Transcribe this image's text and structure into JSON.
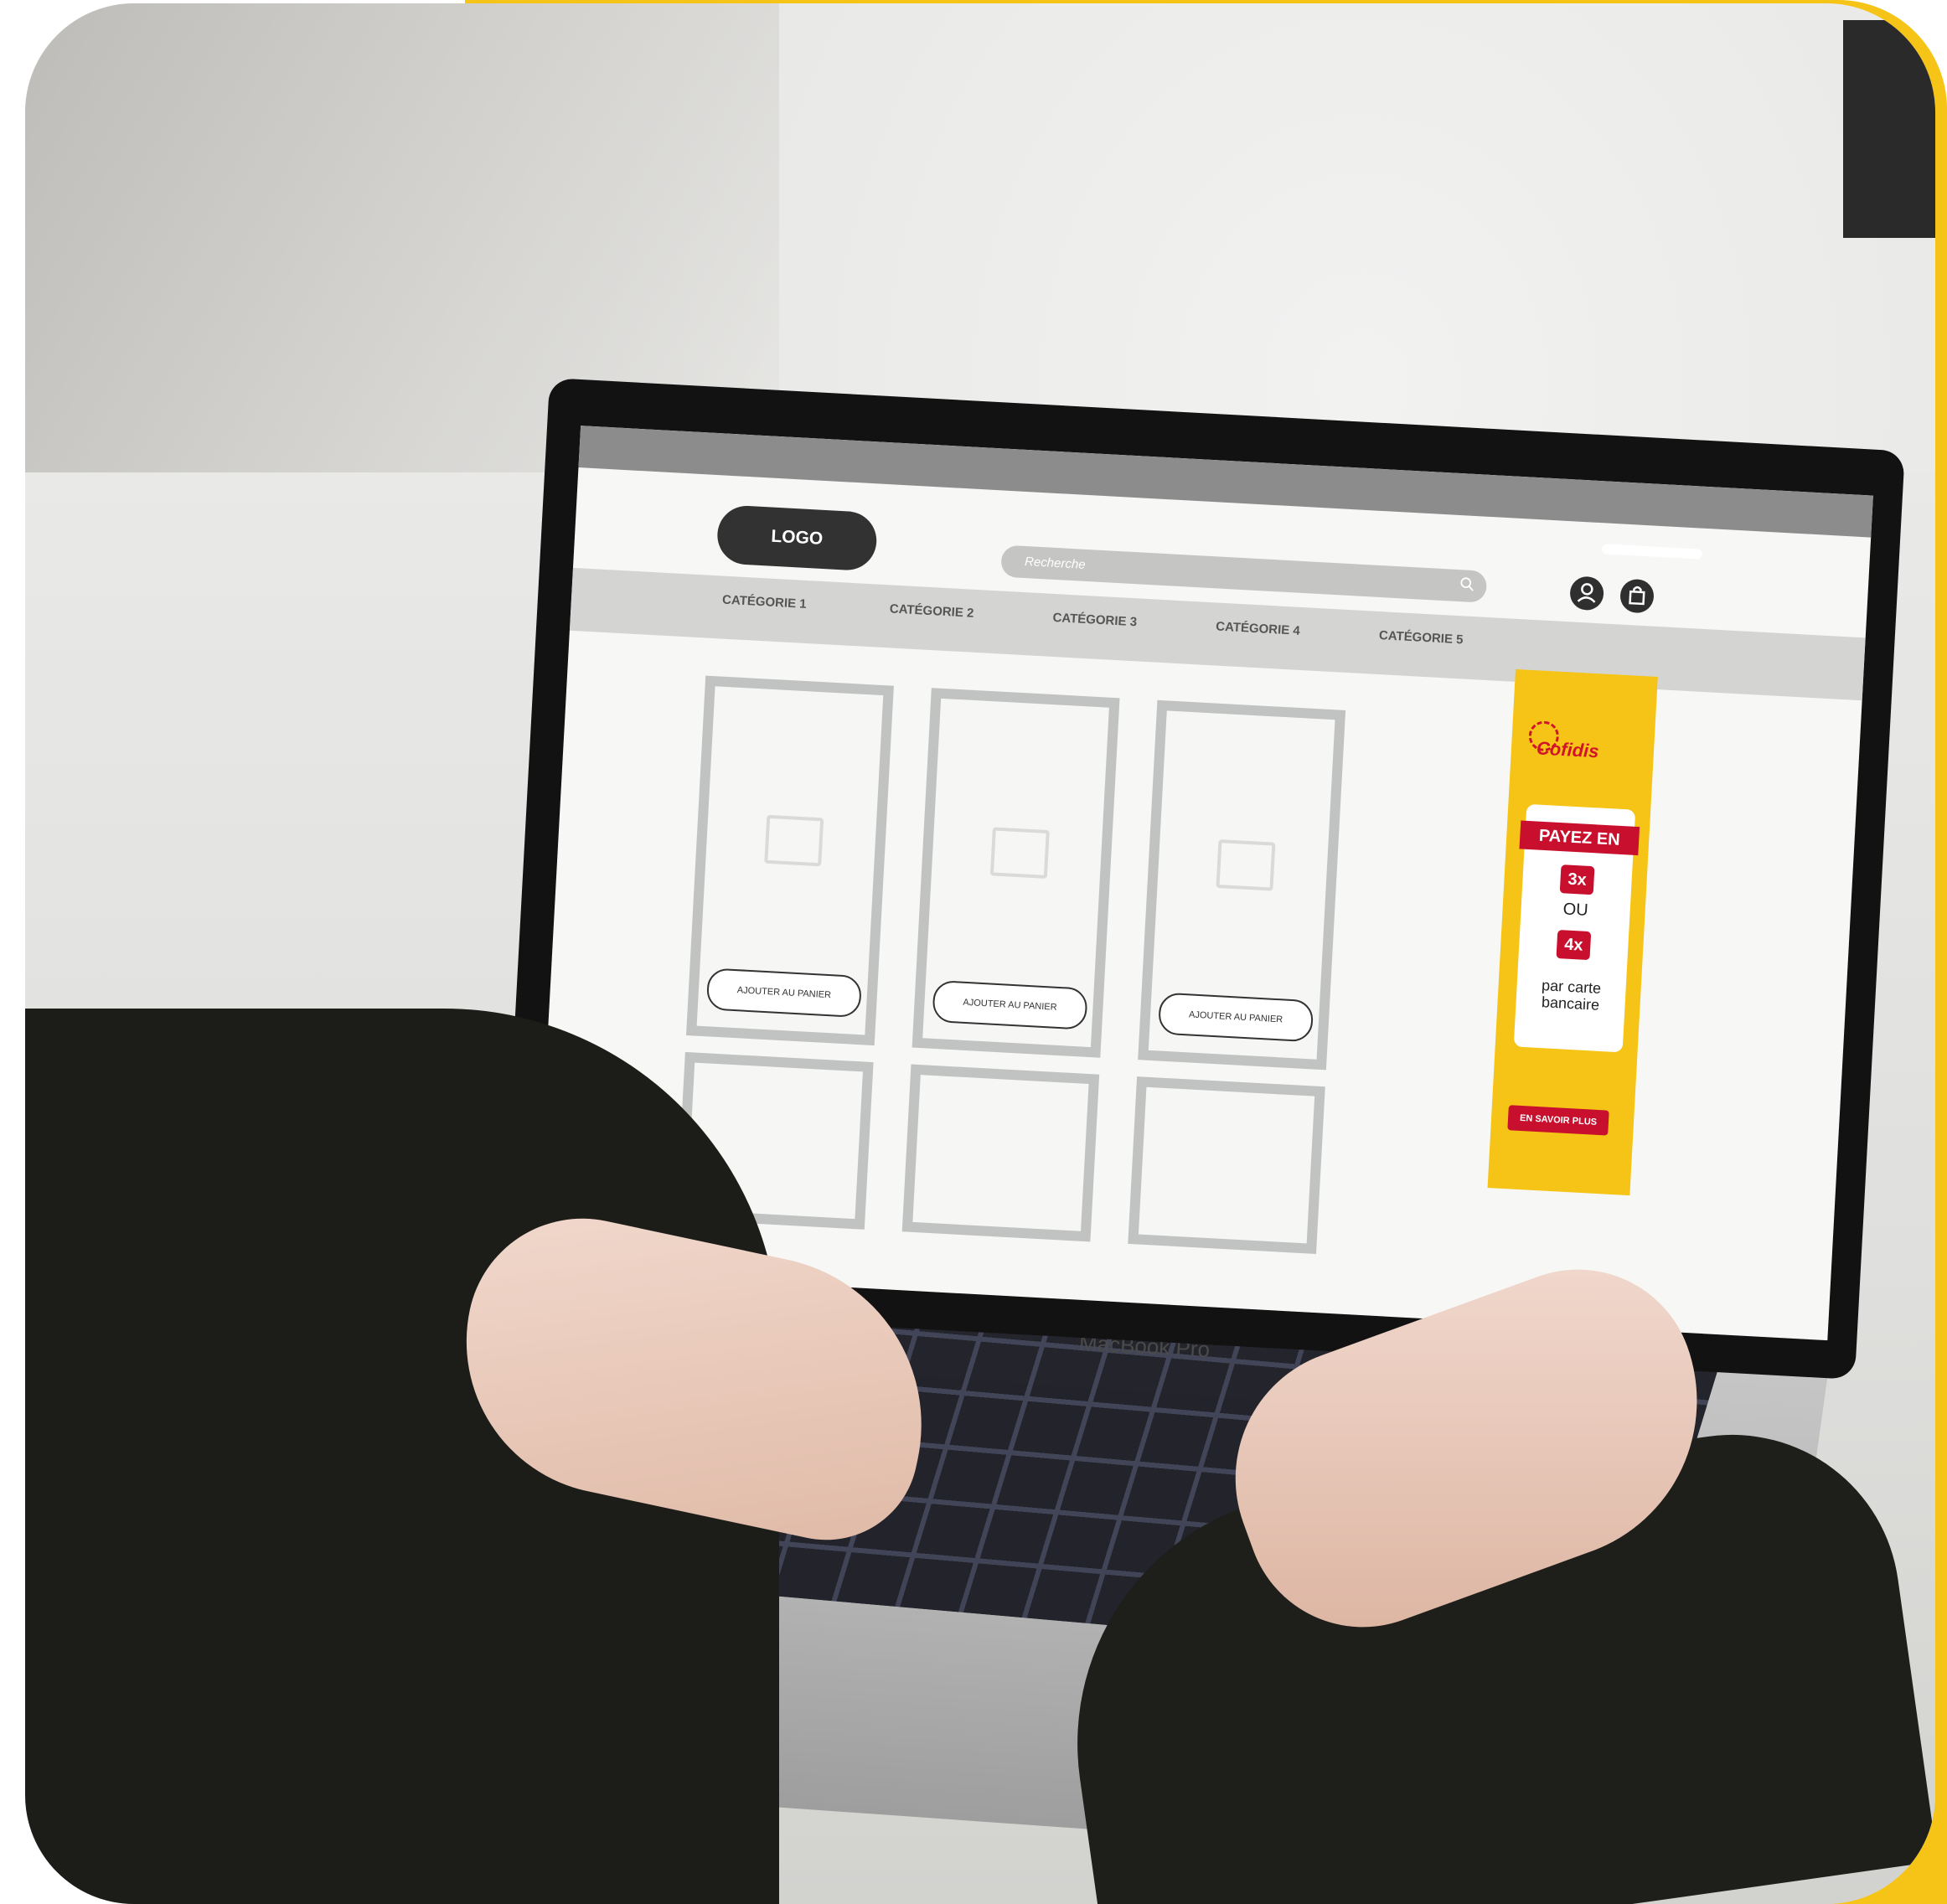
{
  "screen": {
    "logo_label": "LOGO",
    "search_placeholder": "Recherche",
    "nav": [
      "CATÉGORIE 1",
      "CATÉGORIE 2",
      "CATÉGORIE 3",
      "CATÉGORIE 4",
      "CATÉGORIE 5"
    ],
    "add_to_cart_label": "AJOUTER AU PANIER"
  },
  "banner": {
    "brand": "Cofidis",
    "headline": "PAYEZ EN",
    "option_1": "3x",
    "separator": "OU",
    "option_2": "4x",
    "subtext": "par carte bancaire",
    "cta": "EN SAVOIR PLUS"
  },
  "laptop_label": "MacBook Pro",
  "colors": {
    "accent_yellow": "#f6c416",
    "banner_red": "#c8102e"
  }
}
